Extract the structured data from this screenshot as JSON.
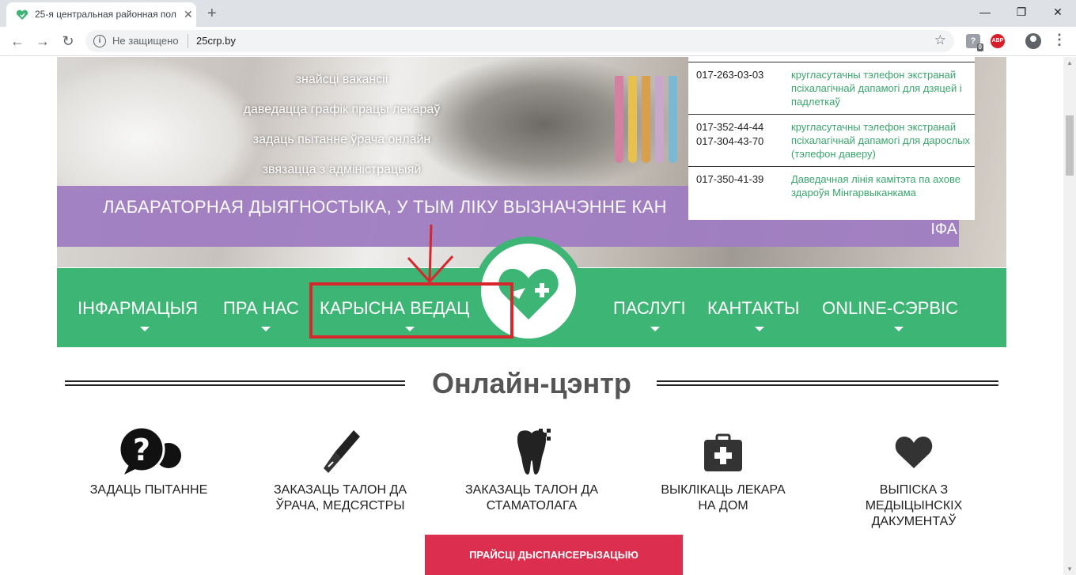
{
  "browser": {
    "tab_title": "25-я центральная районная пол",
    "tab_close": "✕",
    "new_tab": "+",
    "minimize": "—",
    "maximize": "❐",
    "close": "✕",
    "back": "←",
    "forward": "→",
    "reload": "↻",
    "security_label": "Не защищено",
    "url": "25crp.by",
    "star": "☆",
    "ext_badge": "0",
    "abp_label": "ABP",
    "menu": "⋮"
  },
  "hero": {
    "links": [
      "знайсці вакансіі",
      "даведацца графік працы лекараў",
      "задаць пытанне ўрача онлайн",
      "звязацца з адміністрацыяй"
    ],
    "banner_text_line1": "ЛАБАРАТОРНАЯ ДЫЯГНОСТЫКА, У ТЫМ ЛІКУ ВЫЗНАЧЭННЕ КАН",
    "banner_text_line2": "ІФА"
  },
  "phones": [
    {
      "numbers": [
        "017-263-03-03"
      ],
      "description": "кругласутачны тэлефон экстранай псіхалагічнай дапамогі для дзяцей і падлеткаў"
    },
    {
      "numbers": [
        "017-352-44-44",
        "017-304-43-70"
      ],
      "description": "кругласутачны тэлефон экстранай псіхалагічнай дапамогі для дарослых (тэлефон даверу)"
    },
    {
      "numbers": [
        "017-350-41-39"
      ],
      "description": "Даведачная лінія камітэта па ахове здароўя Мінгарвыканкама"
    }
  ],
  "nav": {
    "items": [
      "ІНФАРМАЦЫЯ",
      "ПРА НАС",
      "КАРЫСНА ВЕДАЦ",
      "ПАСЛУГІ",
      "КАНТАКТЫ",
      "ONLINE-СЭРВІС"
    ]
  },
  "online_center": {
    "title": "Онлайн-цэнтр",
    "services": [
      {
        "label": "ЗАДАЦЬ ПЫТАННЕ",
        "icon": "chat-question-icon"
      },
      {
        "label": "ЗАКАЗАЦЬ ТАЛОН ДА\nЎРАЧА, МЕДСЯСТРЫ",
        "icon": "fountain-pen-icon"
      },
      {
        "label": "ЗАКАЗАЦЬ ТАЛОН ДА\nСТАМАТОЛАГА",
        "icon": "tooth-icon"
      },
      {
        "label": "ВЫКЛІКАЦЬ ЛЕКАРА\nНА ДОМ",
        "icon": "medical-kit-icon"
      },
      {
        "label": "ВЫПІСКА З\nМЕДЫЦЫНСКІХ\nДАКУМЕНТАЎ",
        "icon": "heart-icon"
      }
    ],
    "cta_label": "ПРАЙСЦІ ДЫСПАНСЕРЫЗАЦЫЮ"
  },
  "colors": {
    "brand_green": "#3db574",
    "banner_purple": "#a07dc2",
    "cta_red": "#dc2f50",
    "highlight_red": "#d8262c"
  }
}
